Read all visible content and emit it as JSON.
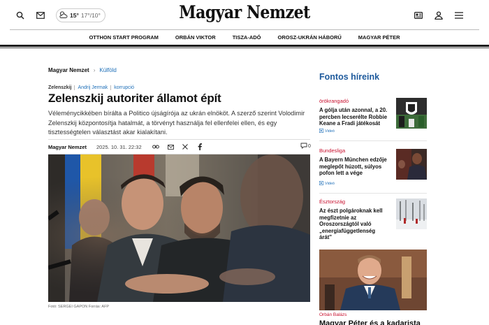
{
  "header": {
    "logo": "Magyar Nemzet",
    "weather": {
      "current": "15°",
      "range": "17°/10°"
    },
    "icons": [
      "search-icon",
      "mail-icon",
      "weather-icon",
      "newsletter-icon",
      "user-icon",
      "menu-icon"
    ]
  },
  "nav": {
    "items": [
      "OTTHON START PROGRAM",
      "ORBÁN VIKTOR",
      "TISZA-ADÓ",
      "OROSZ-UKRÁN HÁBORÚ",
      "MAGYAR PÉTER"
    ]
  },
  "breadcrumb": {
    "home": "Magyar Nemzet",
    "separator": "›",
    "category": "Külföld"
  },
  "article": {
    "tags": [
      "Zelenszkij",
      "Andrij Jermak",
      "korrupció"
    ],
    "title": "Zelenszkij autoriter államot épít",
    "lead": "Véleménycikkében bírálta a Politico újságírója az ukrán elnököt. A szerző szerint Volodimir Zelenszkij központosítja hatalmát, a törvényt használja fel ellenfelei ellen, és egy tisztességtelen választást akar kialakítani.",
    "author": "Magyar Nemzet",
    "date": "2025. 10. 31. 22:32",
    "comment_count": "0",
    "share_icons": [
      "link-icon",
      "email-share-icon",
      "x-icon",
      "facebook-icon"
    ],
    "photo_caption": "Fotó: SERGEI GAPON Forrás: AFP"
  },
  "sidebar": {
    "title": "Fontos híreink",
    "items": [
      {
        "category": "örökrangadó",
        "headline": "A gólja után azonnal, a 20. percben lecserélte Robbie Keane a Fradi játékosát",
        "video": "Videó"
      },
      {
        "category": "Bundesliga",
        "headline": "A Bayern München edzője meglepőt húzott, súlyos pofon lett a vége",
        "video": "Videó"
      },
      {
        "category": "Észtország",
        "headline": "Az észt polgároknak kell megfizetnie az Oroszországtól való „energiafüggetlenség árát”",
        "video": ""
      }
    ],
    "feature": {
      "category": "Orbán Balázs",
      "headline": "Magyar Péter és a kadarista"
    }
  },
  "colors": {
    "accent_blue": "#1e5a9c",
    "link_blue": "#1e6fb8",
    "category_red": "#c8102e"
  }
}
